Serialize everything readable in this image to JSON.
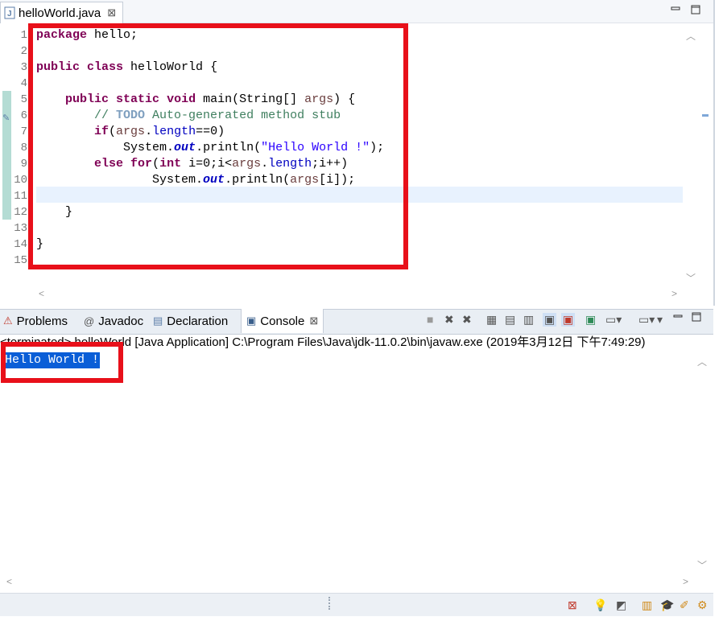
{
  "editor": {
    "tab_label": "helloWorld.java",
    "tab_close": "⊠",
    "minimize": "▭",
    "maximize": "🗖",
    "line_numbers": [
      "1",
      "2",
      "3",
      "4",
      "5",
      "6",
      "7",
      "8",
      "9",
      "10",
      "11",
      "12",
      "13",
      "14",
      "15"
    ],
    "code": {
      "l1_kw": "package",
      "l1_rest": " hello;",
      "l3_kw1": "public",
      "l3_kw2": "class",
      "l3_rest": " helloWorld {",
      "l5_kw1": "public",
      "l5_kw2": "static",
      "l5_kw3": "void",
      "l5_rest1": " main(String[] ",
      "l5_var": "args",
      "l5_rest2": ") {",
      "l6_cm1": "// ",
      "l6_todo": "TODO",
      "l6_cm2": " Auto-generated method stub",
      "l7_kw": "if",
      "l7_a": "(",
      "l7_var": "args",
      "l7_b": ".",
      "l7_fld": "length",
      "l7_c": "==0)",
      "l8_a": "System.",
      "l8_sfld": "out",
      "l8_b": ".println(",
      "l8_str": "\"Hello World !\"",
      "l8_c": ");",
      "l9_kw1": "else",
      "l9_kw2": "for",
      "l9_a": "(",
      "l9_kw3": "int",
      "l9_b": " i=0;i<",
      "l9_var": "args",
      "l9_c": ".",
      "l9_fld": "length",
      "l9_d": ";i++)",
      "l10_a": "System.",
      "l10_sfld": "out",
      "l10_b": ".println(",
      "l10_var": "args",
      "l10_c": "[i]);",
      "l12": "}",
      "l14": "}"
    }
  },
  "console": {
    "tabs": {
      "problems": "Problems",
      "javadoc": "Javadoc",
      "declaration": "Declaration",
      "console": "Console"
    },
    "header": "<terminated> helloWorld [Java Application] C:\\Program Files\\Java\\jdk-11.0.2\\bin\\javaw.exe (2019年3月12日 下午7:49:29)",
    "output": "Hello World !"
  },
  "colors": {
    "highlight": "#e8101a",
    "selection": "#0a5ed7"
  }
}
